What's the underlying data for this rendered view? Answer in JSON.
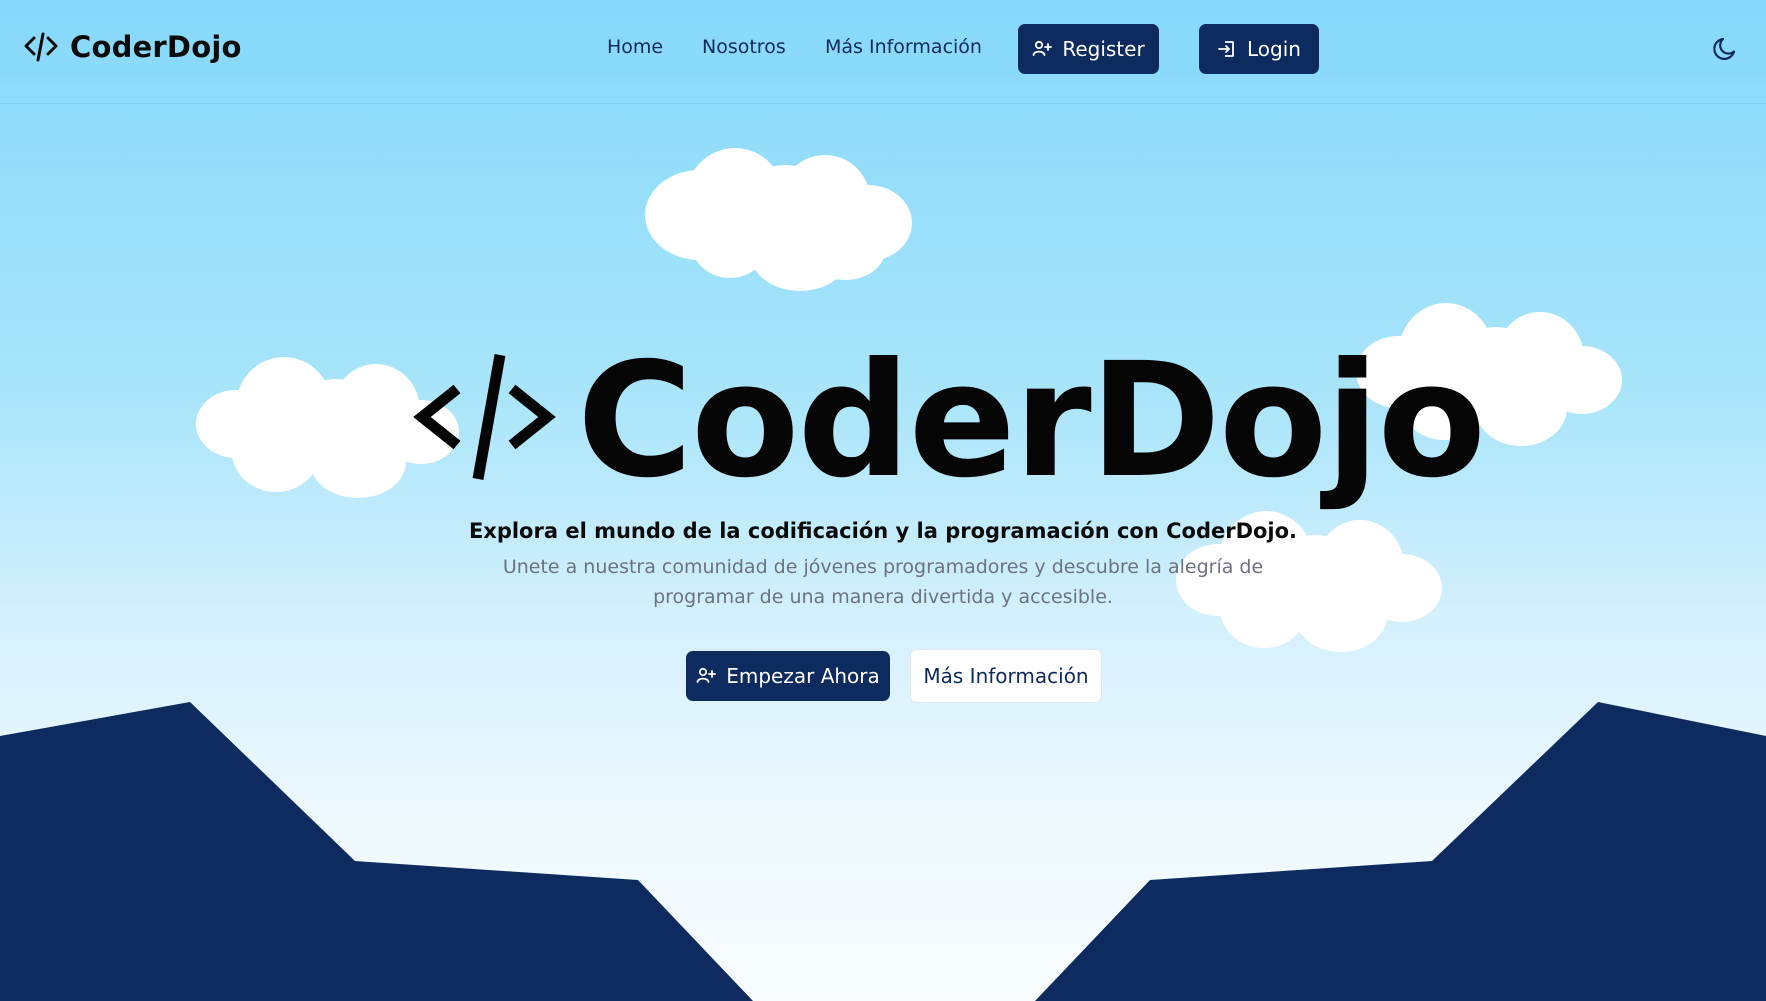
{
  "header": {
    "brand": "CoderDojo",
    "nav": [
      "Home",
      "Nosotros",
      "Más Información"
    ],
    "register_label": "Register",
    "login_label": "Login"
  },
  "hero": {
    "title": "CoderDojo",
    "tagline": "Explora el mundo de la codificación y la programación con CoderDojo.",
    "subtitle_line1": "Unete a nuestra comunidad de jóvenes programadores y descubre la alegría de",
    "subtitle_line2": "programar de una manera divertida y accesible.",
    "primary_cta": "Empezar Ahora",
    "secondary_cta": "Más Información"
  },
  "colors": {
    "navy": "#0e2b5f",
    "sky_top": "#86d8fb",
    "sky_bottom": "#f8fcff",
    "text_muted": "#6b7280"
  },
  "icons": {
    "brand": "code-icon",
    "register": "user-plus-icon",
    "login": "login-icon",
    "theme": "moon-icon"
  }
}
